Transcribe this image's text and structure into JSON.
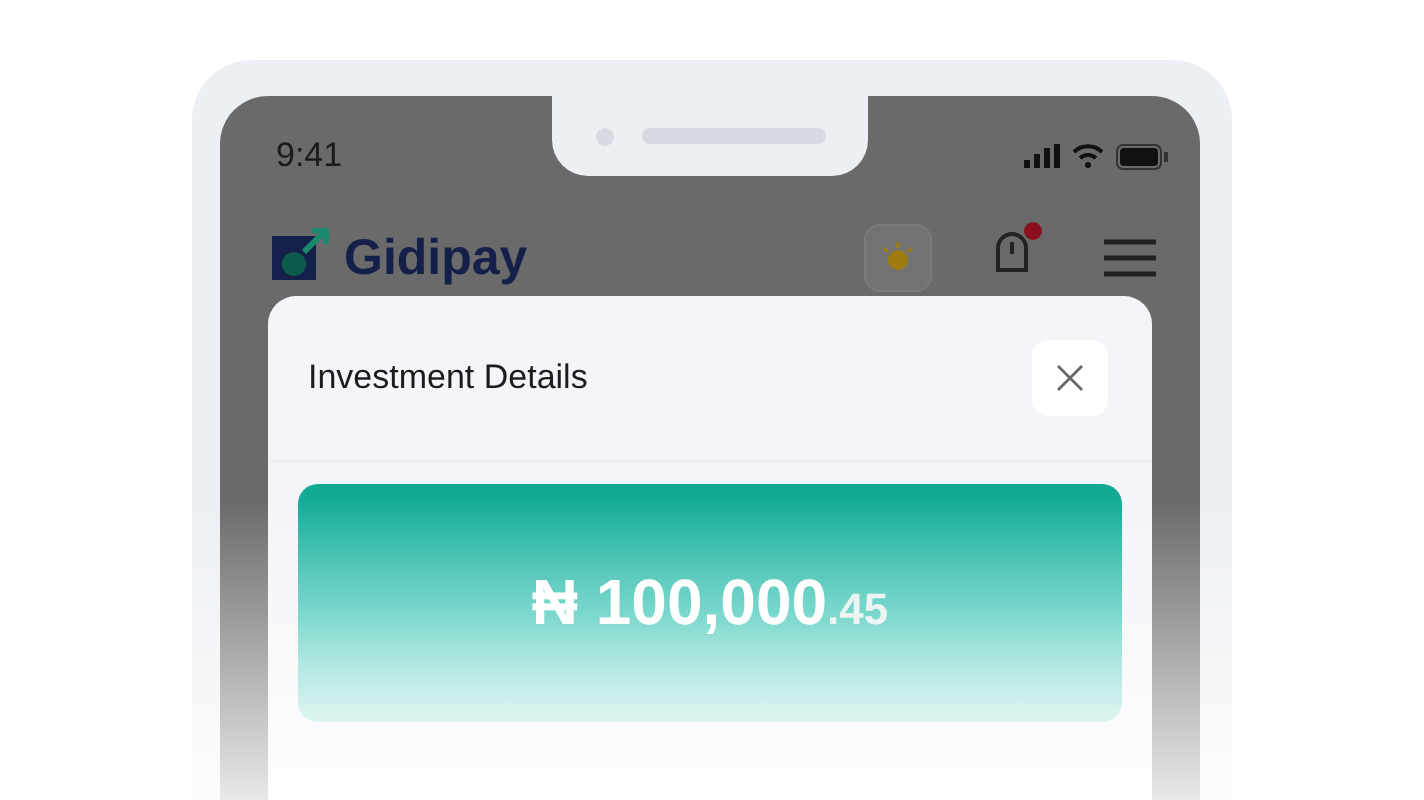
{
  "status_bar": {
    "time": "9:41"
  },
  "header": {
    "brand": "Gidipay",
    "notification_badge": true
  },
  "modal": {
    "title": "Investment Details",
    "amount": {
      "currency": "₦",
      "whole": "100,000",
      "decimals": ".45"
    }
  }
}
